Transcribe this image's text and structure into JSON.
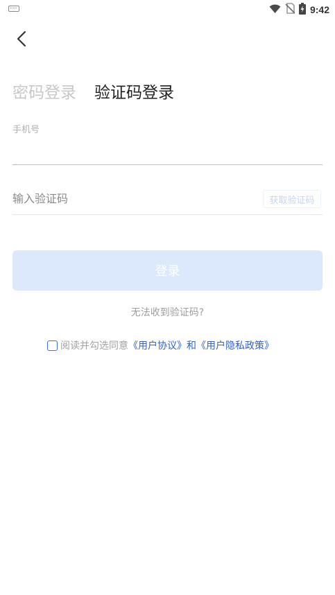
{
  "status_bar": {
    "time": "9:42",
    "icons": [
      "keyboard-icon",
      "wifi-icon",
      "no-sim-icon",
      "battery-charging-icon"
    ]
  },
  "nav": {
    "back_icon": "chevron-left-icon"
  },
  "tabs": {
    "password_login": "密码登录",
    "code_login": "验证码登录",
    "active": "code_login"
  },
  "form": {
    "phone_label": "手机号",
    "phone_value": "",
    "code_placeholder": "输入验证码",
    "code_value": "",
    "get_code_label": "获取验证码"
  },
  "login_button": {
    "label": "登录"
  },
  "help_link": "无法收到验证码?",
  "agreement": {
    "prefix": "阅读并勾选同意",
    "user_agreement": "《用户协议》",
    "and": "和",
    "privacy_policy": "《用户隐私政策》",
    "checked": false
  },
  "colors": {
    "accent": "#2f63c9",
    "login_button_bg": "#dce8fc",
    "input_underline": "#a9c4e2",
    "tab_inactive": "#c7c7c7"
  }
}
